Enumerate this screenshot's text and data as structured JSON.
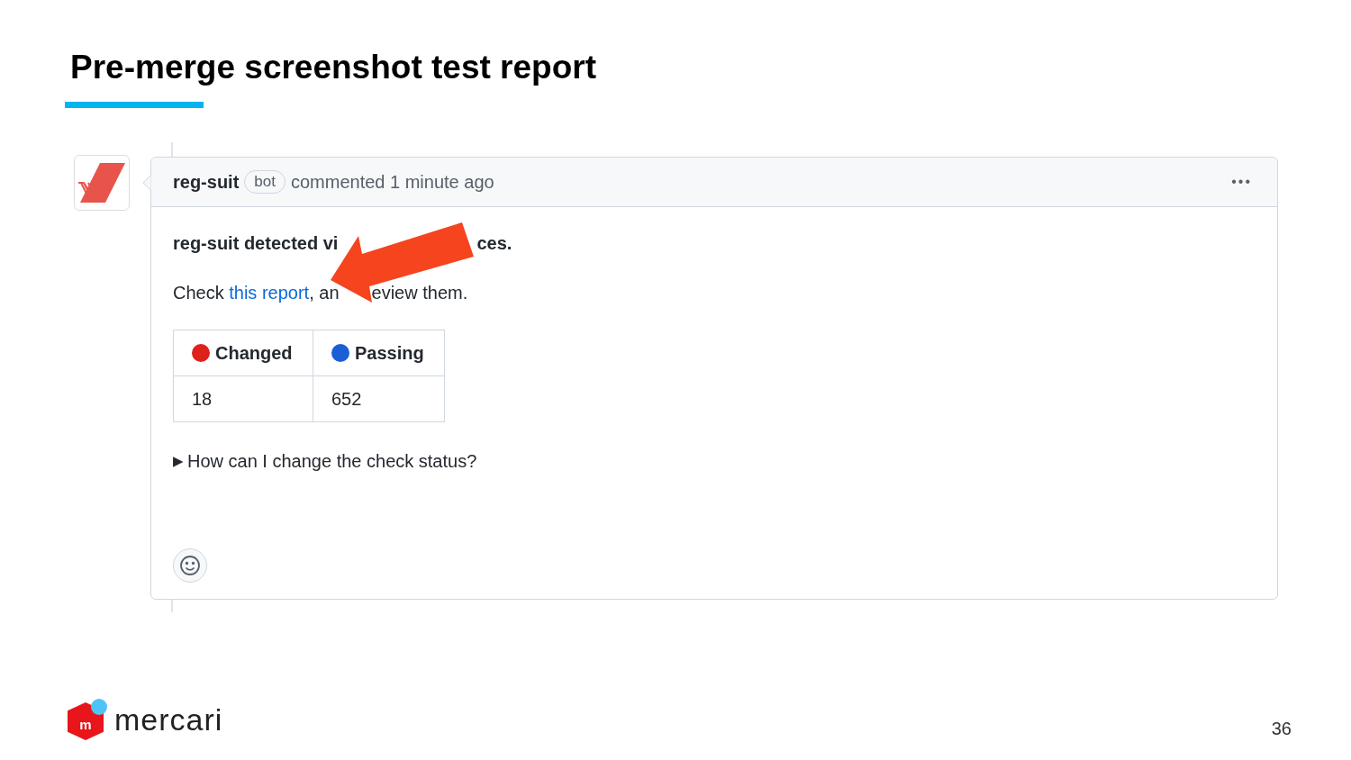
{
  "slide": {
    "title": "Pre-merge screenshot test report",
    "page_number": "36"
  },
  "comment": {
    "author": "reg-suit",
    "badge": "bot",
    "meta": "commented 1 minute ago",
    "menu": "•••",
    "body": {
      "heading": [
        "reg-suit detected vi",
        "ces."
      ],
      "text_before": "Check ",
      "link": "this report",
      "text_after": [
        ", an",
        "eview them."
      ],
      "table": {
        "columns": [
          {
            "label": "Changed",
            "color": "#e0201b"
          },
          {
            "label": "Passing",
            "color": "#1a5fd6"
          }
        ],
        "rows": [
          [
            "18",
            "652"
          ]
        ]
      },
      "details": {
        "marker": "▶",
        "summary": "How can I change the check status?",
        "expanded": false
      }
    }
  },
  "logo": {
    "mark": "m",
    "wordmark": "mercari"
  }
}
